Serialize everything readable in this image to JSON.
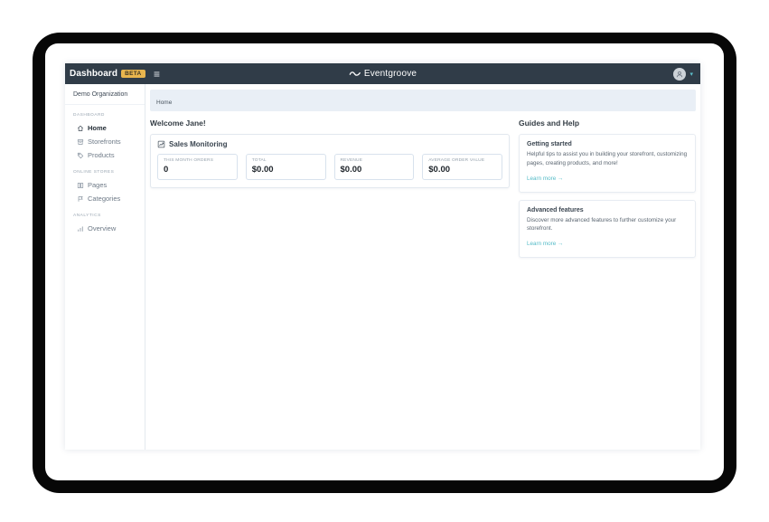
{
  "navbar": {
    "brand": "Dashboard",
    "beta_badge": "BETA",
    "logo_text": "Eventgroove",
    "hamburger_icon": "hamburger-menu-icon",
    "avatar_icon": "user-avatar-icon",
    "caret": "▾"
  },
  "sidebar": {
    "org_name": "Demo Organization",
    "sections": [
      {
        "label": "DASHBOARD",
        "items": [
          {
            "label": "Home",
            "icon": "home-icon",
            "active": true
          },
          {
            "label": "Storefronts",
            "icon": "storefront-icon",
            "active": false
          },
          {
            "label": "Products",
            "icon": "tag-icon",
            "active": false
          }
        ]
      },
      {
        "label": "ONLINE STORES",
        "items": [
          {
            "label": "Pages",
            "icon": "pages-icon",
            "active": false
          },
          {
            "label": "Categories",
            "icon": "category-icon",
            "active": false
          }
        ]
      },
      {
        "label": "ANALYTICS",
        "items": [
          {
            "label": "Overview",
            "icon": "bar-chart-icon",
            "active": false
          }
        ]
      }
    ]
  },
  "breadcrumb": {
    "items": [
      "Home"
    ]
  },
  "main": {
    "welcome": "Welcome Jane!",
    "sales_monitoring": {
      "title": "Sales Monitoring",
      "icon": "line-chart-icon",
      "stats": [
        {
          "label": "THIS MONTH ORDERS",
          "value": "0"
        },
        {
          "label": "TOTAL",
          "value": "$0.00"
        },
        {
          "label": "REVENUE",
          "value": "$0.00"
        },
        {
          "label": "AVERAGE ORDER VALUE",
          "value": "$0.00"
        }
      ]
    }
  },
  "guides": {
    "title": "Guides and Help",
    "cards": [
      {
        "title": "Getting started",
        "body": "Helpful tips to assist you in building your storefront, customizing pages, creating products, and more!",
        "link": "Learn more →"
      },
      {
        "title": "Advanced features",
        "body": "Discover more advanced features to further customize your storefront.",
        "link": "Learn more →"
      }
    ]
  },
  "colors": {
    "navbar_bg": "#303c48",
    "beta_badge_bg": "#e8b54e",
    "link_teal": "#54bbc7",
    "breadcrumb_bg": "#e9eff6",
    "frame_black": "#070707"
  }
}
